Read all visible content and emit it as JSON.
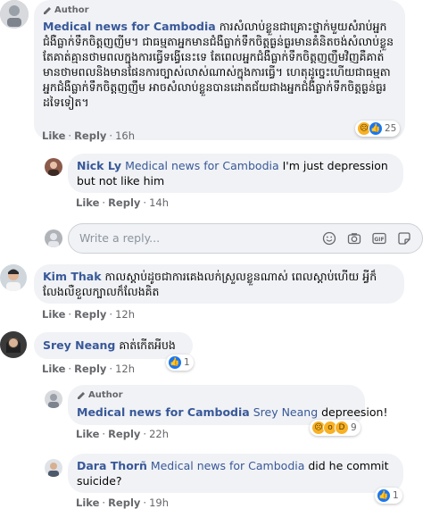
{
  "comment1": {
    "author_tag": "Author",
    "name": "Medical news for Cambodia",
    "text": "ការសំលាប់ខ្លួនជាគ្រោះថ្នាក់មួយសំរាប់អ្នកជំងឺធ្លាក់ទឹកចិត្តញញីម។ ជាធម្មតាអ្នកមានជំងឺធ្លាក់ទឹកចិត្តធ្ងន់ធ្ងរមានគំនិតចង់សំលាប់ខ្លួន តែគាត់គ្មានថាមពលក្នុងការធ្វើទង្វើនេះទេ តែពេលអ្នកជំងឺធ្លាក់ទឹកចិត្តញញឹមវិញគឺគាត់មានថាមពលនិងមានផែនការច្បាស់លាស់ណាស់ក្នុងការធ្វើ។ ហេតុដូច្នេះហើយជាធម្មតាអ្នកជំងឺធ្លាក់ទឹកចិត្តញញឹម អាចសំលាប់ខ្លួនបានដោតជ័យជាងអ្នកជំងឺធ្លាក់ទឹកចិត្តធ្ងន់ធ្ងរដទៃទៀត។",
    "like": "Like",
    "reply": "Reply",
    "time": "16h",
    "reaction_count": "25"
  },
  "reply1": {
    "name": "Nick Ly",
    "mention": "Medical news for Cambodia",
    "text": " I'm just depression but not like him",
    "like": "Like",
    "reply": "Reply",
    "time": "14h"
  },
  "reply_input": {
    "placeholder": "Write a reply..."
  },
  "comment2": {
    "name": "Kim Thak",
    "text": "កាលស្តាប់ដូចជាការគេងលក់ស្រួលខ្លួនណាស់ ពេលស្តាប់ហើយ អ្វីក៏លែងលឺខួលក្បាលក៏លែងគិត",
    "like": "Like",
    "reply": "Reply",
    "time": "12h"
  },
  "comment3": {
    "name": "Srey Neang",
    "text": "គាត់កើតអីបង",
    "like": "Like",
    "reply": "Reply",
    "time": "12h",
    "reaction_count": "1"
  },
  "reply2": {
    "author_tag": "Author",
    "name": "Medical news for Cambodia",
    "mention": "Srey Neang",
    "text": " depreesion!",
    "like": "Like",
    "reply": "Reply",
    "time": "22h",
    "reaction_count": "9"
  },
  "reply3": {
    "name": "Dara Thorñ",
    "mention": "Medical news for Cambodia",
    "text": " did he commit suicide?",
    "like": "Like",
    "reply": "Reply",
    "time": "19h",
    "reaction_count": "1"
  },
  "colors": {
    "link_blue": "#385898",
    "bubble_gray": "#f0f2f5",
    "meta_gray": "#65676b",
    "like_blue": "#1877f2",
    "reaction_yellow": "#f7b125"
  },
  "icons": [
    "pencil-icon",
    "emoji-icon",
    "camera-icon",
    "gif-icon",
    "sticker-icon",
    "like-reaction-icon",
    "sad-reaction-icon",
    "wow-reaction-icon",
    "haha-reaction-icon"
  ]
}
